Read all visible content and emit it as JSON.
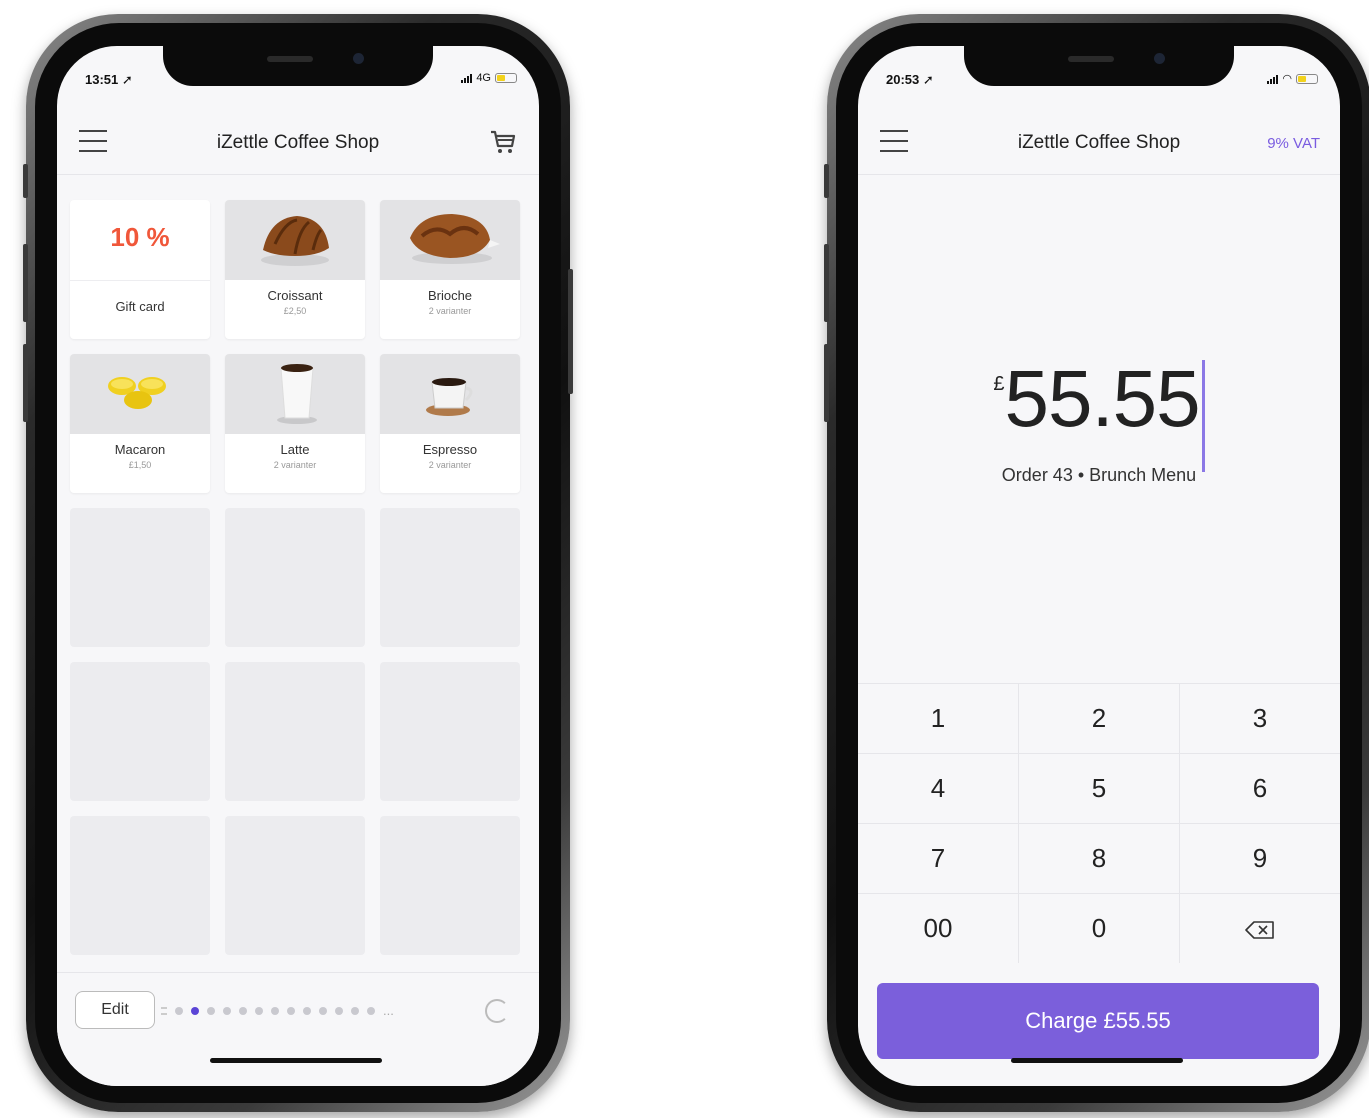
{
  "left_phone": {
    "status": {
      "time": "13:51",
      "network": "4G"
    },
    "header": {
      "title": "iZettle Coffee Shop"
    },
    "tiles": [
      {
        "type": "discount",
        "value": "10 %",
        "label": "Gift card"
      },
      {
        "type": "product",
        "name": "Croissant",
        "sub": "£2,50",
        "image": "croissant"
      },
      {
        "type": "product",
        "name": "Brioche",
        "sub": "2 varianter",
        "image": "brioche"
      },
      {
        "type": "product",
        "name": "Macaron",
        "sub": "£1,50",
        "image": "macaron"
      },
      {
        "type": "product",
        "name": "Latte",
        "sub": "2 varianter",
        "image": "latte"
      },
      {
        "type": "product",
        "name": "Espresso",
        "sub": "2 varianter",
        "image": "espresso"
      }
    ],
    "footer": {
      "edit_label": "Edit",
      "page_count": 14,
      "active_page": 1,
      "more": "..."
    }
  },
  "right_phone": {
    "status": {
      "time": "20:53"
    },
    "header": {
      "title": "iZettle Coffee Shop",
      "vat": "9% VAT"
    },
    "amount": {
      "currency": "£",
      "value": "55.55"
    },
    "order_line": "Order 43 • Brunch Menu",
    "keypad": [
      [
        "1",
        "2",
        "3"
      ],
      [
        "4",
        "5",
        "6"
      ],
      [
        "7",
        "8",
        "9"
      ],
      [
        "00",
        "0",
        "backspace"
      ]
    ],
    "charge_label": "Charge £55.55"
  },
  "colors": {
    "accent": "#7b5fdb",
    "discount": "#f0573a",
    "active_dot": "#5b45d6"
  },
  "icons": [
    "hamburger-icon",
    "cart-icon",
    "backspace-icon",
    "refresh-icon"
  ]
}
